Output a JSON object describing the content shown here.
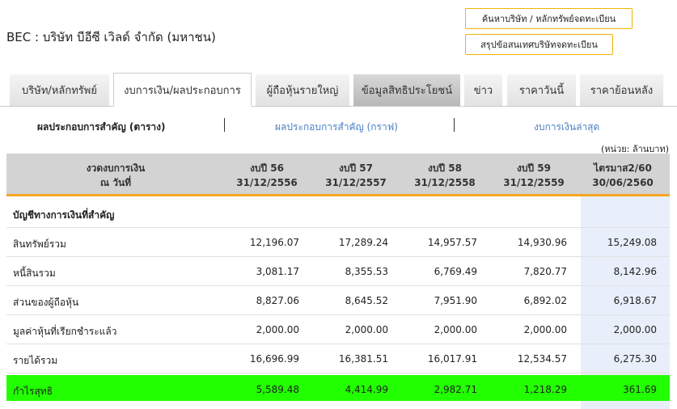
{
  "title": "BEC : บริษัท บีอีซี เวิลด์ จำกัด (มหาชน)",
  "buttons": {
    "search": "ค้นหาบริษัท / หลักทรัพย์จดทะเบียน",
    "summary": "สรุปข้อสนเทศบริษัทจดทะเบียน"
  },
  "tabs": [
    "บริษัท/หลักทรัพย์",
    "งบการเงิน/ผลประกอบการ",
    "ผู้ถือหุ้นรายใหญ่",
    "ข้อมูลสิทธิประโยชน์",
    "ข่าว",
    "ราคาวันนี้",
    "ราคาย้อนหลัง"
  ],
  "subtabs": [
    "ผลประกอบการสำคัญ (ตาราง)",
    "ผลประกอบการสำคัญ (กราฟ)",
    "งบการเงินล่าสุด"
  ],
  "unit": "(หน่วย: ล้านบาท)",
  "table": {
    "header_label": [
      "งวดงบการเงิน",
      "ณ วันที่"
    ],
    "columns": [
      [
        "งบปี 56",
        "31/12/2556"
      ],
      [
        "งบปี 57",
        "31/12/2557"
      ],
      [
        "งบปี 58",
        "31/12/2558"
      ],
      [
        "งบปี 59",
        "31/12/2559"
      ],
      [
        "ไตรมาส2/60",
        "30/06/2560"
      ]
    ],
    "section": "บัญชีทางการเงินที่สำคัญ",
    "rows": [
      {
        "label": "สินทรัพย์รวม",
        "values": [
          "12,196.07",
          "17,289.24",
          "14,957.57",
          "14,930.96",
          "15,249.08"
        ]
      },
      {
        "label": "หนี้สินรวม",
        "values": [
          "3,081.17",
          "8,355.53",
          "6,769.49",
          "7,820.77",
          "8,142.96"
        ]
      },
      {
        "label": "ส่วนของผู้ถือหุ้น",
        "values": [
          "8,827.06",
          "8,645.52",
          "7,951.90",
          "6,892.02",
          "6,918.67"
        ]
      },
      {
        "label": "มูลค่าหุ้นที่เรียกชำระแล้ว",
        "values": [
          "2,000.00",
          "2,000.00",
          "2,000.00",
          "2,000.00",
          "2,000.00"
        ]
      },
      {
        "label": "รายได้รวม",
        "values": [
          "16,696.99",
          "16,381.51",
          "16,017.91",
          "12,534.57",
          "6,275.30"
        ]
      },
      {
        "label": "กำไรสุทธิ",
        "values": [
          "5,589.48",
          "4,414.99",
          "2,982.71",
          "1,218.29",
          "361.69"
        ]
      }
    ]
  },
  "colors": {
    "accent": "#f5a623",
    "highlight": "#22ff00",
    "link": "#4a7fc1"
  }
}
